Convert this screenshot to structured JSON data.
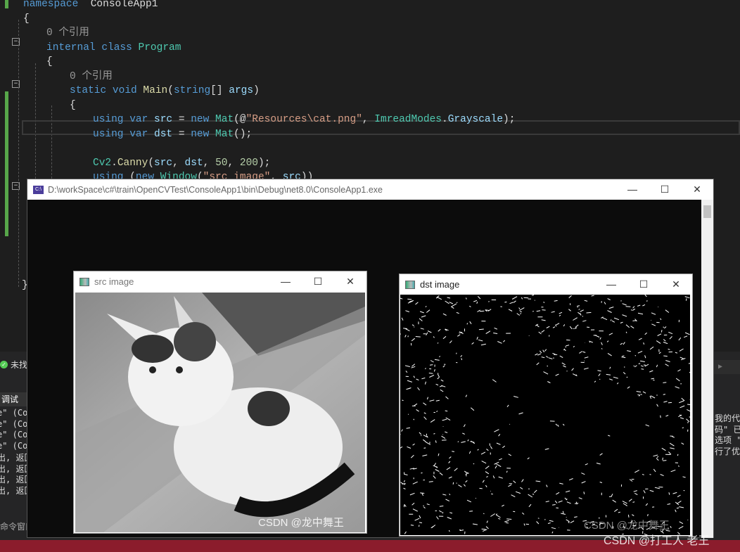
{
  "editor": {
    "lines": [
      {
        "parts": [
          [
            "kw",
            "namespace"
          ],
          [
            "",
            "  "
          ],
          [
            "",
            "ConsoleApp1"
          ]
        ]
      },
      {
        "parts": [
          [
            "",
            "{"
          ]
        ]
      },
      {
        "parts": [
          [
            "cm",
            "0 个引用"
          ]
        ]
      },
      {
        "parts": [
          [
            "kw",
            "internal class "
          ],
          [
            "ty",
            "Program"
          ]
        ]
      },
      {
        "parts": [
          [
            "",
            "{"
          ]
        ]
      },
      {
        "parts": [
          [
            "cm",
            "0 个引用"
          ]
        ]
      },
      {
        "parts": [
          [
            "kw",
            "static void "
          ],
          [
            "fn",
            "Main"
          ],
          [
            "",
            "("
          ],
          [
            "kw",
            "string"
          ],
          [
            "",
            "[] "
          ],
          [
            "va",
            "args"
          ],
          [
            "",
            ")"
          ]
        ]
      },
      {
        "parts": [
          [
            "",
            "{"
          ]
        ]
      },
      {
        "parts": [
          [
            "kw",
            "using var "
          ],
          [
            "va",
            "src"
          ],
          [
            "",
            " = "
          ],
          [
            "kw",
            "new "
          ],
          [
            "ty",
            "Mat"
          ],
          [
            "",
            "(@"
          ],
          [
            "st",
            "\"Resources\\cat.png\""
          ],
          [
            "",
            ", "
          ],
          [
            "ty",
            "ImreadModes"
          ],
          [
            "",
            "."
          ],
          [
            "va",
            "Grayscale"
          ],
          [
            "",
            ");"
          ]
        ]
      },
      {
        "parts": [
          [
            "kw",
            "using var "
          ],
          [
            "va",
            "dst"
          ],
          [
            "",
            " = "
          ],
          [
            "kw",
            "new "
          ],
          [
            "ty",
            "Mat"
          ],
          [
            "",
            "();"
          ]
        ]
      },
      {
        "parts": []
      },
      {
        "parts": [
          [
            "ty",
            "Cv2"
          ],
          [
            "",
            "."
          ],
          [
            "fn",
            "Canny"
          ],
          [
            "",
            "("
          ],
          [
            "va",
            "src"
          ],
          [
            "",
            ", "
          ],
          [
            "va",
            "dst"
          ],
          [
            "",
            ", "
          ],
          [
            "nu",
            "50"
          ],
          [
            "",
            ", "
          ],
          [
            "nu",
            "200"
          ],
          [
            "",
            ");"
          ]
        ]
      },
      {
        "parts": [
          [
            "kw",
            "using "
          ],
          [
            "",
            "("
          ],
          [
            "kw",
            "new "
          ],
          [
            "ty",
            "Window"
          ],
          [
            "",
            "("
          ],
          [
            "st",
            "\"src image\""
          ],
          [
            "",
            ", "
          ],
          [
            "va",
            "src"
          ],
          [
            "",
            "))"
          ]
        ]
      }
    ]
  },
  "status": {
    "text": "未找到"
  },
  "output_panel": {
    "tab": "调试",
    "lines": [
      "e\" (Co",
      "e\" (Co",
      "e\" (Co",
      "e\" (Co",
      "出, 返回",
      "出, 返回",
      "出, 返回",
      "出, 返回"
    ],
    "bottom_tab": "命令窗口"
  },
  "right_panel": {
    "lines": [
      "我的代",
      "码\" 已启",
      "选项 \"",
      "行了优"
    ]
  },
  "console": {
    "title": "D:\\workSpace\\c#\\train\\OpenCVTest\\ConsoleApp1\\bin\\Debug\\net8.0\\ConsoleApp1.exe",
    "icon_label": "C:\\"
  },
  "src_window": {
    "title": "src image",
    "watermark": "CSDN @龙中舞王"
  },
  "dst_window": {
    "title": "dst image",
    "watermark": "CSDN @龙中舞王"
  },
  "window_buttons": {
    "minimize": "—",
    "maximize": "☐",
    "close": "✕"
  },
  "page_watermark": "CSDN @打工人 老王"
}
